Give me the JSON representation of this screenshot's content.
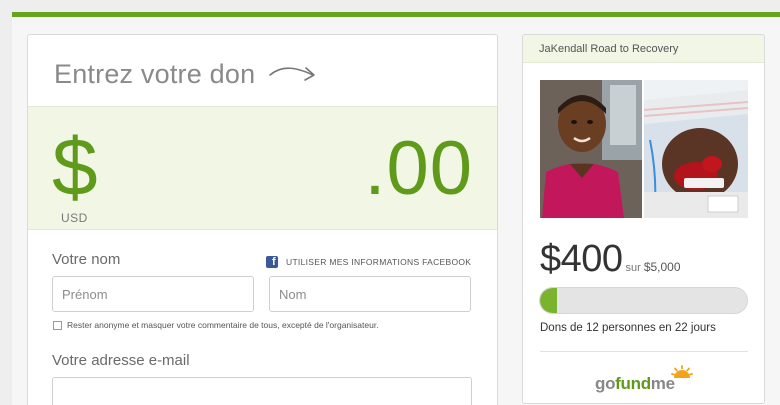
{
  "form": {
    "title": "Entrez votre don",
    "amount": {
      "symbol": "$",
      "currency": "USD",
      "cents": ".00"
    },
    "name_label": "Votre nom",
    "facebook_link": "UTILISER MES INFORMATIONS FACEBOOK",
    "first_name_placeholder": "Prénom",
    "last_name_placeholder": "Nom",
    "anonymous_text": "Rester anonyme et masquer votre commentaire de tous, excepté de l'organisateur.",
    "email_label": "Votre adresse e-mail"
  },
  "campaign": {
    "title": "JaKendall Road to Recovery",
    "raised": "$400",
    "goal_word": "sur",
    "goal": "$5,000",
    "progress_fraction": 0.08,
    "stats": "Dons de 12 personnes en 22 jours",
    "logo": {
      "go": "go",
      "fund": "fund",
      "me": "me"
    }
  },
  "colors": {
    "brand_green": "#5f9a1a",
    "progress_green": "#7ab32e",
    "facebook_blue": "#3b5998"
  }
}
